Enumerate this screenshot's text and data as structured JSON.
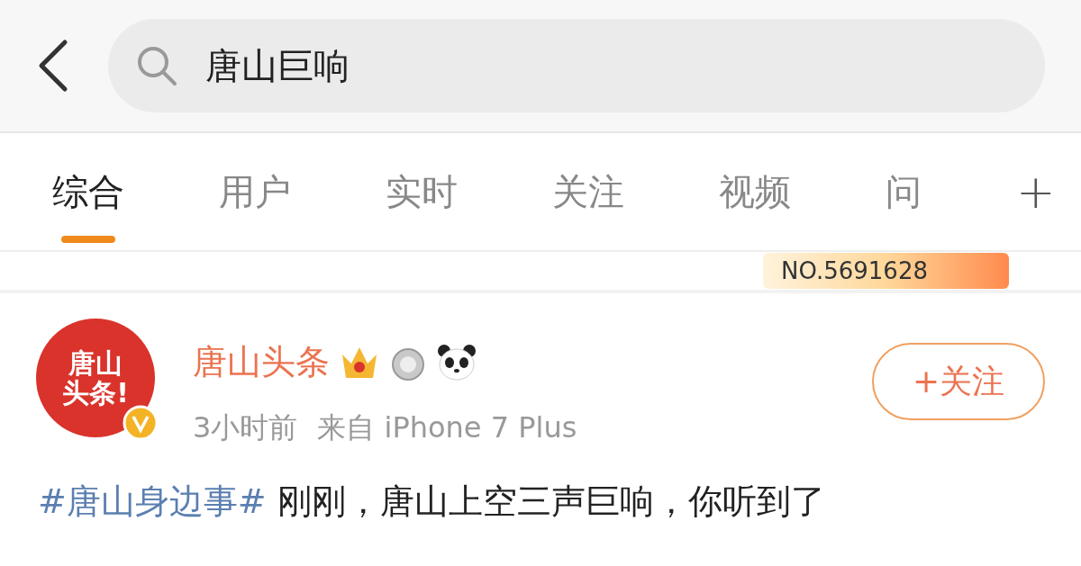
{
  "search": {
    "value": "唐山巨响"
  },
  "tabs": [
    {
      "label": "综合",
      "selected": true
    },
    {
      "label": "用户",
      "selected": false
    },
    {
      "label": "实时",
      "selected": false
    },
    {
      "label": "关注",
      "selected": false
    },
    {
      "label": "视频",
      "selected": false
    },
    {
      "label": "问",
      "selected": false
    }
  ],
  "tabs_add": "+",
  "prev_card": {
    "badge": "NO.5691628"
  },
  "post": {
    "author": "唐山头条",
    "avatar_text": "唐山头条!",
    "time": "3小时前",
    "source": "来自 iPhone 7 Plus",
    "follow_button": "+关注",
    "hashtag": "#唐山身边事#",
    "text": "刚刚，唐山上空三声巨响，你听到了"
  }
}
